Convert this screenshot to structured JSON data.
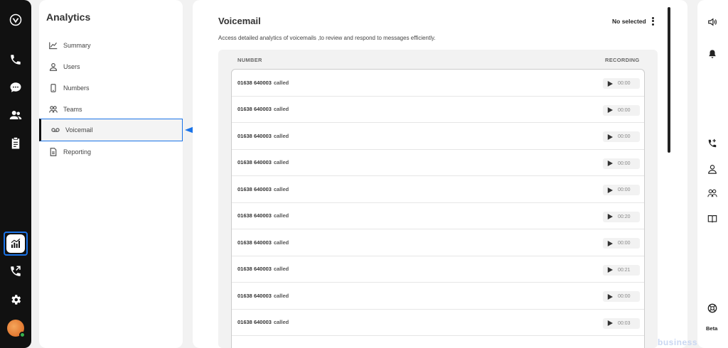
{
  "sidebar_rail": {
    "icons": [
      "logo-icon",
      "phone-icon",
      "chat-icon",
      "contacts-icon",
      "clipboard-icon",
      "analytics-icon",
      "call-forward-icon",
      "settings-icon"
    ]
  },
  "nav": {
    "title": "Analytics",
    "items": [
      {
        "label": "Summary",
        "icon": "trend-icon"
      },
      {
        "label": "Users",
        "icon": "user-icon"
      },
      {
        "label": "Numbers",
        "icon": "mobile-icon"
      },
      {
        "label": "Teams",
        "icon": "teams-icon"
      },
      {
        "label": "Voicemail",
        "icon": "voicemail-icon"
      },
      {
        "label": "Reporting",
        "icon": "report-icon"
      }
    ]
  },
  "main": {
    "title": "Voicemail",
    "subtitle": "Access detailed analytics of voicemails ,to review and respond to messages efficiently.",
    "selection_status": "No selected",
    "columns": {
      "number": "NUMBER",
      "recording": "RECORDING"
    },
    "rows": [
      {
        "number": "01638 640003",
        "suffix": "called",
        "duration": "00:00"
      },
      {
        "number": "01638 640003",
        "suffix": "called",
        "duration": "00:00"
      },
      {
        "number": "01638 640003",
        "suffix": "called",
        "duration": "00:00"
      },
      {
        "number": "01638 640003",
        "suffix": "called",
        "duration": "00:00"
      },
      {
        "number": "01638 640003",
        "suffix": "called",
        "duration": "00:00"
      },
      {
        "number": "01638 640003",
        "suffix": "called",
        "duration": "00:20"
      },
      {
        "number": "01638 640003",
        "suffix": "called",
        "duration": "00:00"
      },
      {
        "number": "01638 640003",
        "suffix": "called",
        "duration": "00:21"
      },
      {
        "number": "01638 640003",
        "suffix": "called",
        "duration": "00:00"
      },
      {
        "number": "01638 640003",
        "suffix": "called",
        "duration": "00:03"
      }
    ]
  },
  "right_panel": {
    "icons": [
      "speaker-icon",
      "bell-icon",
      "phone-plus-icon",
      "user-icon",
      "users-icon",
      "book-icon",
      "help-icon"
    ],
    "beta_label": "Beta"
  },
  "watermark": "business",
  "colors": {
    "accent": "#1a73e8",
    "rail": "#111111"
  }
}
